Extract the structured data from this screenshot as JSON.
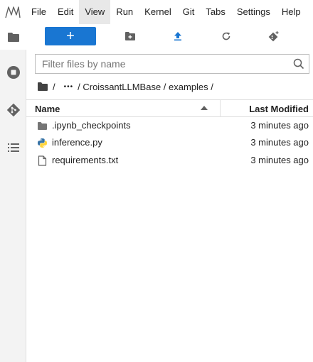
{
  "menu": {
    "items": [
      "File",
      "Edit",
      "View",
      "Run",
      "Kernel",
      "Git",
      "Tabs",
      "Settings",
      "Help"
    ],
    "active": "View"
  },
  "sidebar": {
    "tabs": [
      {
        "name": "running-terminals-kernels",
        "icon": "stop-circle-icon"
      },
      {
        "name": "git",
        "icon": "git-icon"
      },
      {
        "name": "table-of-contents",
        "icon": "list-icon"
      }
    ]
  },
  "toolbar": {
    "new_label": "+",
    "buttons": [
      "new-launcher",
      "new-folder",
      "upload",
      "refresh",
      "git-clone"
    ]
  },
  "filter": {
    "placeholder": "Filter files by name",
    "value": ""
  },
  "breadcrumbs": {
    "root": "/",
    "ellipsis": "•••",
    "path": "/ CroissantLLMBase / examples /"
  },
  "file_list": {
    "headers": {
      "name": "Name",
      "modified": "Last Modified"
    },
    "sort": "ascending",
    "rows": [
      {
        "name": ".ipynb_checkpoints",
        "modified": "3 minutes ago",
        "type": "folder"
      },
      {
        "name": "inference.py",
        "modified": "3 minutes ago",
        "type": "python"
      },
      {
        "name": "requirements.txt",
        "modified": "3 minutes ago",
        "type": "text"
      }
    ]
  },
  "colors": {
    "accent": "#1976d2",
    "icon_gray": "#616161",
    "python_blue": "#3572a5",
    "python_yellow": "#ffd43b"
  }
}
